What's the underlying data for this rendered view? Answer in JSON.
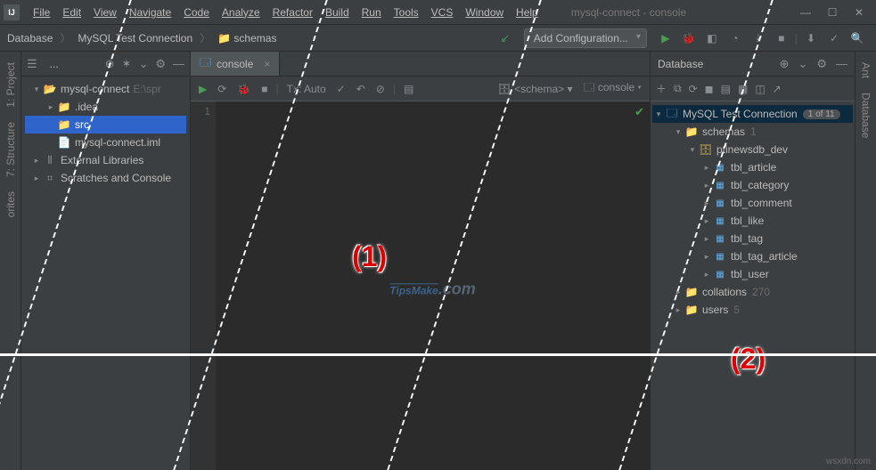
{
  "menubar": {
    "logo": "IJ",
    "items": [
      "File",
      "Edit",
      "View",
      "Navigate",
      "Code",
      "Analyze",
      "Refactor",
      "Build",
      "Run",
      "Tools",
      "VCS",
      "Window",
      "Help"
    ],
    "title": "mysql-connect - console"
  },
  "navbar": {
    "crumbs": [
      "Database",
      "MySQL Test Connection",
      "schemas"
    ],
    "add_conf": "Add Configuration..."
  },
  "sidebar_left": {
    "labels": [
      "1: Project",
      "7: Structure",
      "orites"
    ]
  },
  "sidebar_right": {
    "labels": [
      "Ant",
      "Database"
    ]
  },
  "project_panel": {
    "selector": "...",
    "items": [
      {
        "indent": 0,
        "exp": "▾",
        "icon": "folder-open",
        "label": "mysql-connect",
        "hint": "E:\\spr"
      },
      {
        "indent": 1,
        "exp": "▸",
        "icon": "folder",
        "label": ".idea"
      },
      {
        "indent": 1,
        "exp": "",
        "icon": "folder-blue",
        "label": "src",
        "selected": true
      },
      {
        "indent": 1,
        "exp": "",
        "icon": "file",
        "label": "mysql-connect.iml"
      },
      {
        "indent": 0,
        "exp": "▸",
        "icon": "lib",
        "label": "External Libraries"
      },
      {
        "indent": 0,
        "exp": "▸",
        "icon": "scratch",
        "label": "Scratches and Console"
      }
    ]
  },
  "editor": {
    "tab_label": "console",
    "toolbar": {
      "tx": "Tx: Auto",
      "schema_sel": "<schema>",
      "console_sel": "console"
    },
    "gutter_line": "1"
  },
  "db_panel": {
    "title": "Database",
    "connection": {
      "name": "MySQL Test Connection",
      "badge": "1 of 11"
    },
    "tree": [
      {
        "indent": 1,
        "exp": "▾",
        "icon": "folder-blue",
        "label": "schemas",
        "count": "1"
      },
      {
        "indent": 2,
        "exp": "▾",
        "icon": "db",
        "label": "ptinewsdb_dev"
      },
      {
        "indent": 3,
        "exp": "▸",
        "icon": "table",
        "label": "tbl_article"
      },
      {
        "indent": 3,
        "exp": "▸",
        "icon": "table",
        "label": "tbl_category"
      },
      {
        "indent": 3,
        "exp": "▸",
        "icon": "table",
        "label": "tbl_comment"
      },
      {
        "indent": 3,
        "exp": "▸",
        "icon": "table",
        "label": "tbl_like"
      },
      {
        "indent": 3,
        "exp": "▸",
        "icon": "table",
        "label": "tbl_tag"
      },
      {
        "indent": 3,
        "exp": "▸",
        "icon": "table",
        "label": "tbl_tag_article"
      },
      {
        "indent": 3,
        "exp": "▸",
        "icon": "table",
        "label": "tbl_user"
      },
      {
        "indent": 1,
        "exp": "▸",
        "icon": "folder-blue",
        "label": "collations",
        "count": "270"
      },
      {
        "indent": 1,
        "exp": "▸",
        "icon": "folder-blue",
        "label": "users",
        "count": "5"
      }
    ]
  },
  "annotations": {
    "a1": "(1)",
    "a2": "(2)"
  },
  "watermark": {
    "text": "TipsMake",
    "suffix": ".com"
  },
  "footer": "wsxdn.com"
}
